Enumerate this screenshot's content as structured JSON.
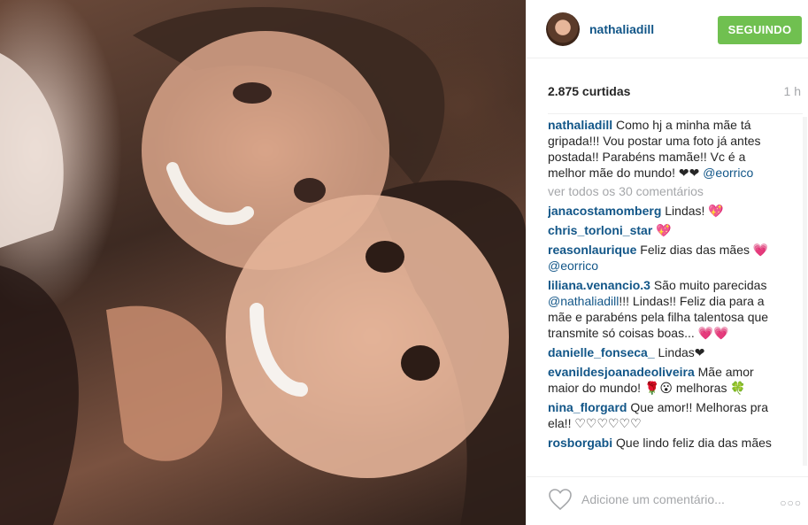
{
  "post": {
    "username": "nathaliadill",
    "follow_label": "SEGUINDO",
    "likes": "2.875 curtidas",
    "time": "1 h",
    "caption_user": "nathaliadill",
    "caption_text": " Como hj a minha mãe tá gripada!!! Vou postar uma foto já antes postada!! Parabéns mamãe!! Vc é a melhor mãe do mundo! ❤❤ ",
    "caption_mention": "@eorrico",
    "view_all": "ver todos os 30 comentários",
    "comments": [
      {
        "user": "janacostamomberg",
        "text": " Lindas! 💖",
        "mention": ""
      },
      {
        "user": "chris_torloni_star",
        "text": " 💖",
        "mention": ""
      },
      {
        "user": "reasonlaurique",
        "text": " Feliz dias das mães 💗 ",
        "mention": "@eorrico"
      },
      {
        "user": "liliana.venancio.3",
        "text": " São muito parecidas ",
        "mention": "@nathaliadill",
        "tail": "!!! Lindas!! Feliz dia para a mãe e parabéns pela filha talentosa que transmite só coisas boas... 💗💗"
      },
      {
        "user": "danielle_fonseca_",
        "text": " Lindas❤",
        "mention": ""
      },
      {
        "user": "evanildesjoanadeoliveira",
        "text": " Mãe amor maior do mundo! 🌹😮 melhoras 🍀",
        "mention": ""
      },
      {
        "user": "nina_florgard",
        "text": " Que amor!! Melhoras pra ela!! ♡♡♡♡♡♡",
        "mention": ""
      },
      {
        "user": "rosborgabi",
        "text": " Que lindo feliz dia das mães",
        "mention": ""
      }
    ],
    "add_comment_placeholder": "Adicione um comentário...",
    "more_label": "○○○"
  },
  "colors": {
    "link": "#125688",
    "follow": "#70c050",
    "muted": "#a5a7aa"
  }
}
